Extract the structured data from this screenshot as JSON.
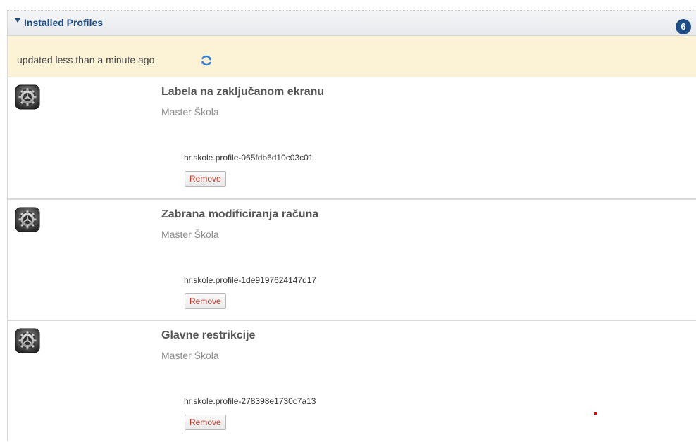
{
  "panel": {
    "title": "Installed Profiles",
    "count": "6",
    "status": "updated less than a minute ago"
  },
  "profiles": [
    {
      "name": "Labela na zaključanom ekranu",
      "organization": "Master Škola",
      "identifier": "hr.skole.profile-065fdb6d10c03c01",
      "remove_label": "Remove"
    },
    {
      "name": "Zabrana modificiranja računa",
      "organization": "Master Škola",
      "identifier": "hr.skole.profile-1de9197624147d17",
      "remove_label": "Remove"
    },
    {
      "name": "Glavne restrikcije",
      "organization": "Master Škola",
      "identifier": "hr.skole.profile-278398e1730c7a13",
      "remove_label": "Remove"
    }
  ],
  "icons": {
    "toggle": "caret-down-icon",
    "refresh": "refresh-icon",
    "profile": "settings-gear-icon"
  },
  "colors": {
    "accent": "#1f4e86",
    "status_background": "#fcf2d6",
    "remove_text": "#c0392b"
  }
}
